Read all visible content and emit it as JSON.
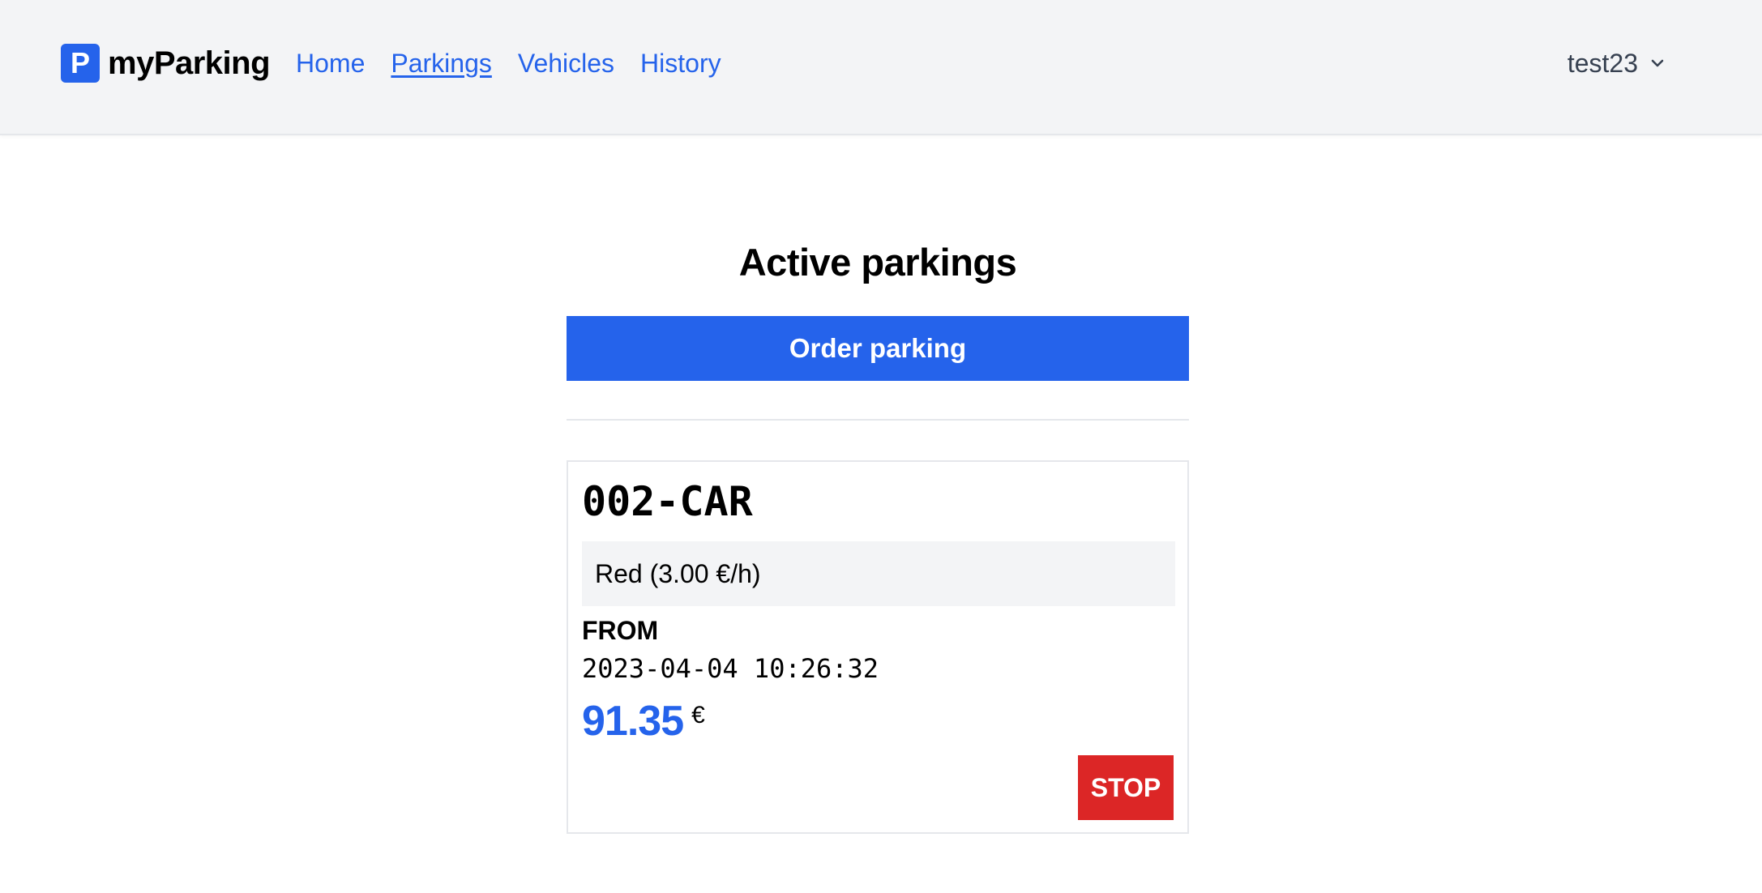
{
  "header": {
    "logo_letter": "P",
    "brand_name": "myParking",
    "nav": [
      {
        "label": "Home"
      },
      {
        "label": "Parkings",
        "active": true
      },
      {
        "label": "Vehicles"
      },
      {
        "label": "History"
      }
    ],
    "user": "test23"
  },
  "main": {
    "title": "Active parkings",
    "order_button": "Order parking",
    "parkings": [
      {
        "plate": "002-CAR",
        "zone": "Red (3.00 €/h)",
        "from_label": "FROM",
        "from_value": "2023-04-04 10:26:32",
        "amount": "91.35",
        "currency": "€",
        "stop_label": "STOP"
      }
    ]
  },
  "colors": {
    "accent": "#2563eb",
    "danger": "#dc2626",
    "header_bg": "#f3f4f6"
  },
  "icons": {
    "logo": "parking-logo-icon",
    "user_menu": "chevron-down-icon"
  }
}
